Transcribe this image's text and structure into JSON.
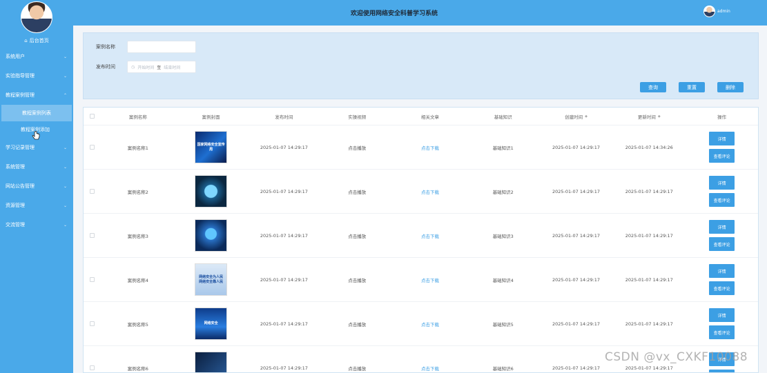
{
  "header": {
    "title": "欢迎使用网络安全科普学习系统",
    "username": "admin"
  },
  "sidebar": {
    "home_label": "后台首页",
    "items": [
      {
        "label": "系统用户",
        "children": []
      },
      {
        "label": "实验指导管理",
        "children": []
      },
      {
        "label": "教程案例管理",
        "children": [
          "教程案例列表",
          "教程案例添加"
        ]
      },
      {
        "label": "学习记录管理",
        "children": []
      },
      {
        "label": "系统管理",
        "children": []
      },
      {
        "label": "网站公告管理",
        "children": []
      },
      {
        "label": "资源管理",
        "children": []
      },
      {
        "label": "交流管理",
        "children": []
      }
    ]
  },
  "search": {
    "name_label": "案例名称",
    "time_label": "发布时间",
    "start_placeholder": "开始时间",
    "range_sep": "至",
    "end_placeholder": "结束时间",
    "query_button": "查询",
    "reset_button": "重置",
    "delete_button": "删除"
  },
  "table": {
    "columns": [
      "案例名称",
      "案例封面",
      "发布时间",
      "实操视频",
      "相关文章",
      "基础知识",
      "创建时间",
      "更新时间",
      "操作"
    ],
    "rows": [
      {
        "name": "案例名称1",
        "publish_time": "2025-01-07 14:29:17",
        "video": "点击播放",
        "article": "点击下载",
        "knowledge": "基础知识1",
        "created": "2025-01-07 14:29:17",
        "updated": "2025-01-07 14:34:26"
      },
      {
        "name": "案例名称2",
        "publish_time": "2025-01-07 14:29:17",
        "video": "点击播放",
        "article": "点击下载",
        "knowledge": "基础知识2",
        "created": "2025-01-07 14:29:17",
        "updated": "2025-01-07 14:29:17"
      },
      {
        "name": "案例名称3",
        "publish_time": "2025-01-07 14:29:17",
        "video": "点击播放",
        "article": "点击下载",
        "knowledge": "基础知识3",
        "created": "2025-01-07 14:29:17",
        "updated": "2025-01-07 14:29:17"
      },
      {
        "name": "案例名称4",
        "publish_time": "2025-01-07 14:29:17",
        "video": "点击播放",
        "article": "点击下载",
        "knowledge": "基础知识4",
        "created": "2025-01-07 14:29:17",
        "updated": "2025-01-07 14:29:17"
      },
      {
        "name": "案例名称5",
        "publish_time": "2025-01-07 14:29:17",
        "video": "点击播放",
        "article": "点击下载",
        "knowledge": "基础知识5",
        "created": "2025-01-07 14:29:17",
        "updated": "2025-01-07 14:29:17"
      },
      {
        "name": "案例名称6",
        "publish_time": "2025-01-07 14:29:17",
        "video": "点击播放",
        "article": "点击下载",
        "knowledge": "基础知识6",
        "created": "2025-01-07 14:29:17",
        "updated": "2025-01-07 14:29:17"
      }
    ],
    "detail_button": "详情",
    "comments_button": "查看评论"
  },
  "thumb_text": [
    "国家网络安全宣传周",
    "",
    "",
    "网络安全为人民 网络安全靠人民",
    "网络安全",
    ""
  ],
  "watermark": "CSDN @vx_CXKF10088",
  "colors": {
    "brand": "#4aa9e9",
    "button": "#3c9fe4",
    "search_panel": "#d8e9f8"
  }
}
